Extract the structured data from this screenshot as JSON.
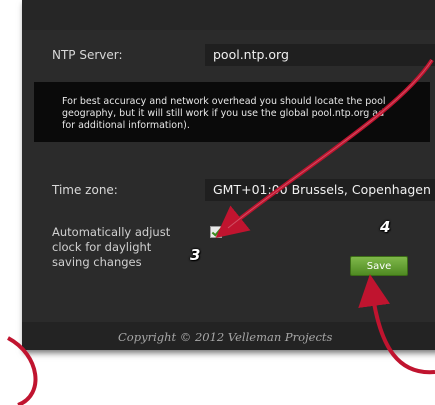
{
  "ntp": {
    "label": "NTP Server:",
    "value": "pool.ntp.org"
  },
  "info": {
    "lines": [
      "For best accuracy and network overhead you should locate the pool",
      "geography, but it will still work if you use the global pool.ntp.org ad",
      "for additional information)."
    ]
  },
  "timezone": {
    "label": "Time zone:",
    "value": "GMT+01:00 Brussels, Copenhagen"
  },
  "dst": {
    "label": "Automatically adjust clock for daylight saving changes",
    "checked": true
  },
  "save_label": "Save",
  "footer": {
    "copyright": "Copyright © 2012 Velleman Projects"
  },
  "callouts": {
    "three": "3",
    "four": "4"
  },
  "colors": {
    "arrow": "#c0142f",
    "accent_green": "#5f9a2a"
  }
}
